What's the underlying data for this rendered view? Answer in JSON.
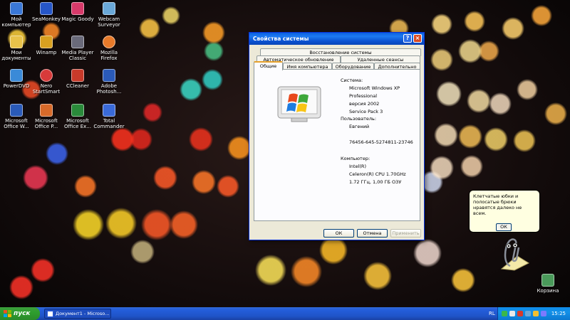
{
  "desktop": {
    "icons": [
      {
        "label1": "Мой",
        "label2": "компьютер",
        "color": "#3a78d8"
      },
      {
        "label1": "SeaMonkey",
        "label2": "",
        "color": "#2656c8"
      },
      {
        "label1": "Magic Goody",
        "label2": "",
        "color": "#d83a6a"
      },
      {
        "label1": "Webcam",
        "label2": "Surveyor",
        "color": "#6aa8d8"
      },
      {
        "label1": "Мои",
        "label2": "документы",
        "color": "#e8c24a"
      },
      {
        "label1": "Winamp",
        "label2": "",
        "color": "#d8a020"
      },
      {
        "label1": "Media Player",
        "label2": "Classic",
        "color": "#6a6a7a"
      },
      {
        "label1": "Mozilla Firefox",
        "label2": "",
        "color": "#e87a2a"
      },
      {
        "label1": "PowerDVD",
        "label2": "",
        "color": "#3a8ad8"
      },
      {
        "label1": "Nero",
        "label2": "StartSmart",
        "color": "#d83a3a"
      },
      {
        "label1": "CCleaner",
        "label2": "",
        "color": "#c83a2a"
      },
      {
        "label1": "Adobe",
        "label2": "Photosh...",
        "color": "#2a5ab8"
      },
      {
        "label1": "Microsoft",
        "label2": "Office W...",
        "color": "#2a5ab8"
      },
      {
        "label1": "Microsoft",
        "label2": "Office P...",
        "color": "#d86a2a"
      },
      {
        "label1": "Microsoft",
        "label2": "Office Ex...",
        "color": "#2a8a3a"
      },
      {
        "label1": "Total",
        "label2": "Commander",
        "color": "#3a6ad8"
      }
    ],
    "recycle_bin": "Корзина"
  },
  "dialog": {
    "title": "Свойства системы",
    "help_glyph": "?",
    "close_glyph": "×",
    "tabs_row1": [
      "Восстановление системы"
    ],
    "tabs_row2": [
      "Автоматическое обновление",
      "Удаленные сеансы"
    ],
    "tabs_row3": [
      "Общие",
      "Имя компьютера",
      "Оборудование",
      "Дополнительно"
    ],
    "system_heading": "Система:",
    "system_lines": [
      "Microsoft Windows XP",
      "Professional",
      "версия 2002",
      "Service Pack 3"
    ],
    "user_heading": "Пользователь:",
    "user_lines": [
      "Евгений",
      "",
      "76456-645-5274811-23746"
    ],
    "computer_heading": "Компьютер:",
    "computer_lines": [
      "Intel(R)",
      "Celeron(R) CPU 1.70GHz",
      "1.72 ГГц, 1,00 ГБ ОЗУ"
    ],
    "buttons": {
      "ok": "ОК",
      "cancel": "Отмена",
      "apply": "Применить"
    }
  },
  "clippy": {
    "text": "Клетчатые юбки и полосатые брюки нравятся далеко не всем.",
    "ok": "ОК"
  },
  "taskbar": {
    "start": "пуск",
    "task": "Документ1 - Microso...",
    "lang": "RL",
    "time": "15:25"
  }
}
